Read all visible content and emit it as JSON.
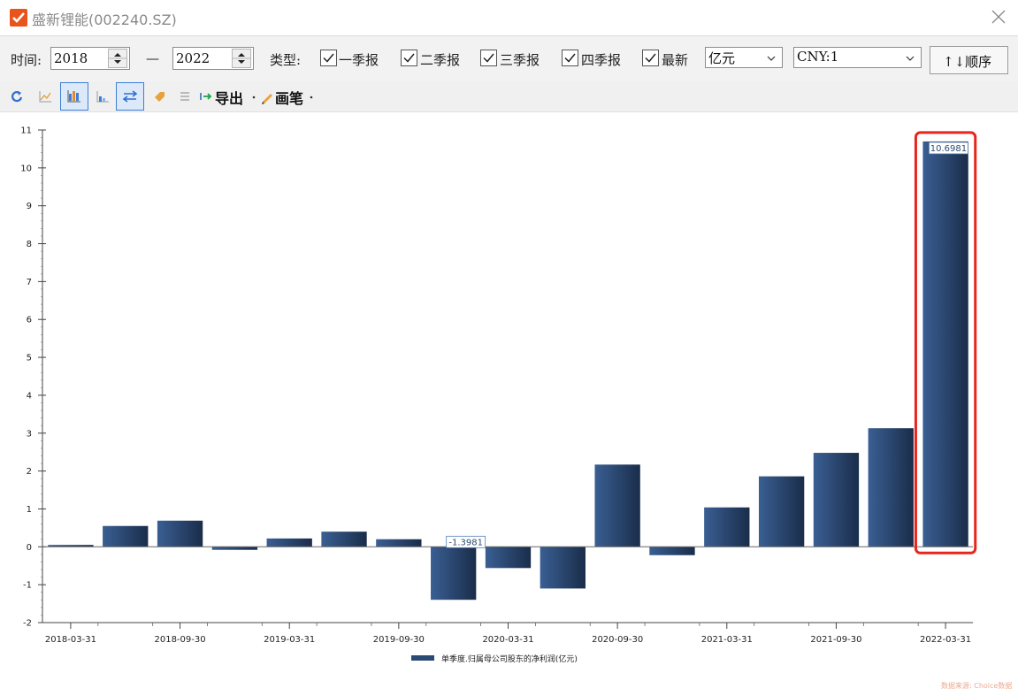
{
  "window": {
    "title": "盛新锂能(002240.SZ)",
    "accent_color": "#e8541c"
  },
  "filters": {
    "time_label": "时间:",
    "start_year": "2018",
    "separator": "—",
    "end_year": "2022",
    "type_label": "类型:",
    "checkboxes": [
      {
        "label": "一季报",
        "checked": true
      },
      {
        "label": "二季报",
        "checked": true
      },
      {
        "label": "三季报",
        "checked": true
      },
      {
        "label": "四季报",
        "checked": true
      },
      {
        "label": "最新",
        "checked": true
      }
    ],
    "unit_select": "亿元",
    "currency_select": "CNY:1",
    "sort_button": "↑↓顺序"
  },
  "toolbar": {
    "icons": [
      "refresh-icon",
      "line-chart-icon",
      "bar-chart-icon",
      "area-chart-icon",
      "compare-icon",
      "tag-icon",
      "list-icon"
    ],
    "export_label": "导出",
    "pen_label": "画笔"
  },
  "chart_data": {
    "type": "bar",
    "title": "",
    "xlabel": "",
    "ylabel": "",
    "ylim": [
      -2,
      11
    ],
    "y_ticks": [
      "-2",
      "-1",
      "0",
      "1",
      "2",
      "3",
      "4",
      "5",
      "6",
      "7",
      "8",
      "9",
      "10",
      "11"
    ],
    "x_tick_labels": [
      "2018-03-31",
      "2018-09-30",
      "2019-03-31",
      "2019-09-30",
      "2020-03-31",
      "2020-09-30",
      "2021-03-31",
      "2021-09-30",
      "2022-03-31"
    ],
    "categories": [
      "2018-03-31",
      "2018-06-30",
      "2018-09-30",
      "2018-12-31",
      "2019-03-31",
      "2019-06-30",
      "2019-09-30",
      "2019-12-31",
      "2020-03-31",
      "2020-06-30",
      "2020-09-30",
      "2020-12-31",
      "2021-03-31",
      "2021-06-30",
      "2021-09-30",
      "2021-12-31",
      "2022-03-31"
    ],
    "series": [
      {
        "name": "单季度.归属母公司股东的净利润(亿元)",
        "values": [
          0.05,
          0.55,
          0.69,
          -0.08,
          0.22,
          0.4,
          0.2,
          -1.3981,
          -0.56,
          -1.1,
          2.17,
          -0.22,
          1.04,
          1.86,
          2.48,
          3.13,
          10.6981
        ],
        "color": "#2b4a73"
      }
    ],
    "data_labels": [
      {
        "category": "2019-12-31",
        "text": "-1.3981"
      },
      {
        "category": "2022-03-31",
        "text": "10.6981"
      }
    ],
    "highlight": {
      "category": "2022-03-31",
      "color": "#e8251c"
    },
    "legend": "bottom-center",
    "grid": false
  },
  "footer": {
    "source": "数据来源: Choice数据"
  }
}
